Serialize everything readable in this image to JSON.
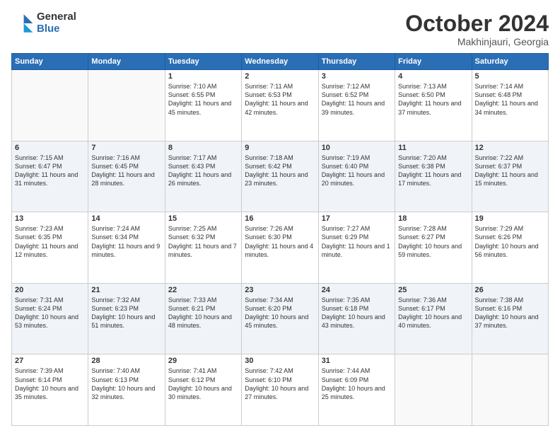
{
  "logo": {
    "general": "General",
    "blue": "Blue"
  },
  "title": {
    "month_year": "October 2024",
    "location": "Makhinjauri, Georgia"
  },
  "weekdays": [
    "Sunday",
    "Monday",
    "Tuesday",
    "Wednesday",
    "Thursday",
    "Friday",
    "Saturday"
  ],
  "weeks": [
    [
      {
        "day": "",
        "info": ""
      },
      {
        "day": "",
        "info": ""
      },
      {
        "day": "1",
        "info": "Sunrise: 7:10 AM\nSunset: 6:55 PM\nDaylight: 11 hours and 45 minutes."
      },
      {
        "day": "2",
        "info": "Sunrise: 7:11 AM\nSunset: 6:53 PM\nDaylight: 11 hours and 42 minutes."
      },
      {
        "day": "3",
        "info": "Sunrise: 7:12 AM\nSunset: 6:52 PM\nDaylight: 11 hours and 39 minutes."
      },
      {
        "day": "4",
        "info": "Sunrise: 7:13 AM\nSunset: 6:50 PM\nDaylight: 11 hours and 37 minutes."
      },
      {
        "day": "5",
        "info": "Sunrise: 7:14 AM\nSunset: 6:48 PM\nDaylight: 11 hours and 34 minutes."
      }
    ],
    [
      {
        "day": "6",
        "info": "Sunrise: 7:15 AM\nSunset: 6:47 PM\nDaylight: 11 hours and 31 minutes."
      },
      {
        "day": "7",
        "info": "Sunrise: 7:16 AM\nSunset: 6:45 PM\nDaylight: 11 hours and 28 minutes."
      },
      {
        "day": "8",
        "info": "Sunrise: 7:17 AM\nSunset: 6:43 PM\nDaylight: 11 hours and 26 minutes."
      },
      {
        "day": "9",
        "info": "Sunrise: 7:18 AM\nSunset: 6:42 PM\nDaylight: 11 hours and 23 minutes."
      },
      {
        "day": "10",
        "info": "Sunrise: 7:19 AM\nSunset: 6:40 PM\nDaylight: 11 hours and 20 minutes."
      },
      {
        "day": "11",
        "info": "Sunrise: 7:20 AM\nSunset: 6:38 PM\nDaylight: 11 hours and 17 minutes."
      },
      {
        "day": "12",
        "info": "Sunrise: 7:22 AM\nSunset: 6:37 PM\nDaylight: 11 hours and 15 minutes."
      }
    ],
    [
      {
        "day": "13",
        "info": "Sunrise: 7:23 AM\nSunset: 6:35 PM\nDaylight: 11 hours and 12 minutes."
      },
      {
        "day": "14",
        "info": "Sunrise: 7:24 AM\nSunset: 6:34 PM\nDaylight: 11 hours and 9 minutes."
      },
      {
        "day": "15",
        "info": "Sunrise: 7:25 AM\nSunset: 6:32 PM\nDaylight: 11 hours and 7 minutes."
      },
      {
        "day": "16",
        "info": "Sunrise: 7:26 AM\nSunset: 6:30 PM\nDaylight: 11 hours and 4 minutes."
      },
      {
        "day": "17",
        "info": "Sunrise: 7:27 AM\nSunset: 6:29 PM\nDaylight: 11 hours and 1 minute."
      },
      {
        "day": "18",
        "info": "Sunrise: 7:28 AM\nSunset: 6:27 PM\nDaylight: 10 hours and 59 minutes."
      },
      {
        "day": "19",
        "info": "Sunrise: 7:29 AM\nSunset: 6:26 PM\nDaylight: 10 hours and 56 minutes."
      }
    ],
    [
      {
        "day": "20",
        "info": "Sunrise: 7:31 AM\nSunset: 6:24 PM\nDaylight: 10 hours and 53 minutes."
      },
      {
        "day": "21",
        "info": "Sunrise: 7:32 AM\nSunset: 6:23 PM\nDaylight: 10 hours and 51 minutes."
      },
      {
        "day": "22",
        "info": "Sunrise: 7:33 AM\nSunset: 6:21 PM\nDaylight: 10 hours and 48 minutes."
      },
      {
        "day": "23",
        "info": "Sunrise: 7:34 AM\nSunset: 6:20 PM\nDaylight: 10 hours and 45 minutes."
      },
      {
        "day": "24",
        "info": "Sunrise: 7:35 AM\nSunset: 6:18 PM\nDaylight: 10 hours and 43 minutes."
      },
      {
        "day": "25",
        "info": "Sunrise: 7:36 AM\nSunset: 6:17 PM\nDaylight: 10 hours and 40 minutes."
      },
      {
        "day": "26",
        "info": "Sunrise: 7:38 AM\nSunset: 6:16 PM\nDaylight: 10 hours and 37 minutes."
      }
    ],
    [
      {
        "day": "27",
        "info": "Sunrise: 7:39 AM\nSunset: 6:14 PM\nDaylight: 10 hours and 35 minutes."
      },
      {
        "day": "28",
        "info": "Sunrise: 7:40 AM\nSunset: 6:13 PM\nDaylight: 10 hours and 32 minutes."
      },
      {
        "day": "29",
        "info": "Sunrise: 7:41 AM\nSunset: 6:12 PM\nDaylight: 10 hours and 30 minutes."
      },
      {
        "day": "30",
        "info": "Sunrise: 7:42 AM\nSunset: 6:10 PM\nDaylight: 10 hours and 27 minutes."
      },
      {
        "day": "31",
        "info": "Sunrise: 7:44 AM\nSunset: 6:09 PM\nDaylight: 10 hours and 25 minutes."
      },
      {
        "day": "",
        "info": ""
      },
      {
        "day": "",
        "info": ""
      }
    ]
  ]
}
